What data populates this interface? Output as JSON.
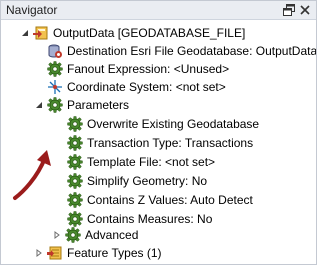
{
  "panel": {
    "title": "Navigator"
  },
  "tree": {
    "root": "OutputData [GEODATABASE_FILE]",
    "items": [
      "Destination Esri File Geodatabase: OutputData",
      "Fanout Expression: <Unused>",
      "Coordinate System: <not set>"
    ],
    "parameters": "Parameters",
    "params": [
      "Overwrite Existing Geodatabase",
      "Transaction Type: Transactions",
      "Template File: <not set>",
      "Simplify Geometry: No",
      "Contains Z Values: Auto Detect",
      "Contains Measures: No"
    ],
    "advanced": "Advanced",
    "feature_types": "Feature Types (1)"
  },
  "colors": {
    "gear": "#4a8a2e",
    "arrow": "#9b1c1c",
    "accent": "#1b6fb5"
  }
}
